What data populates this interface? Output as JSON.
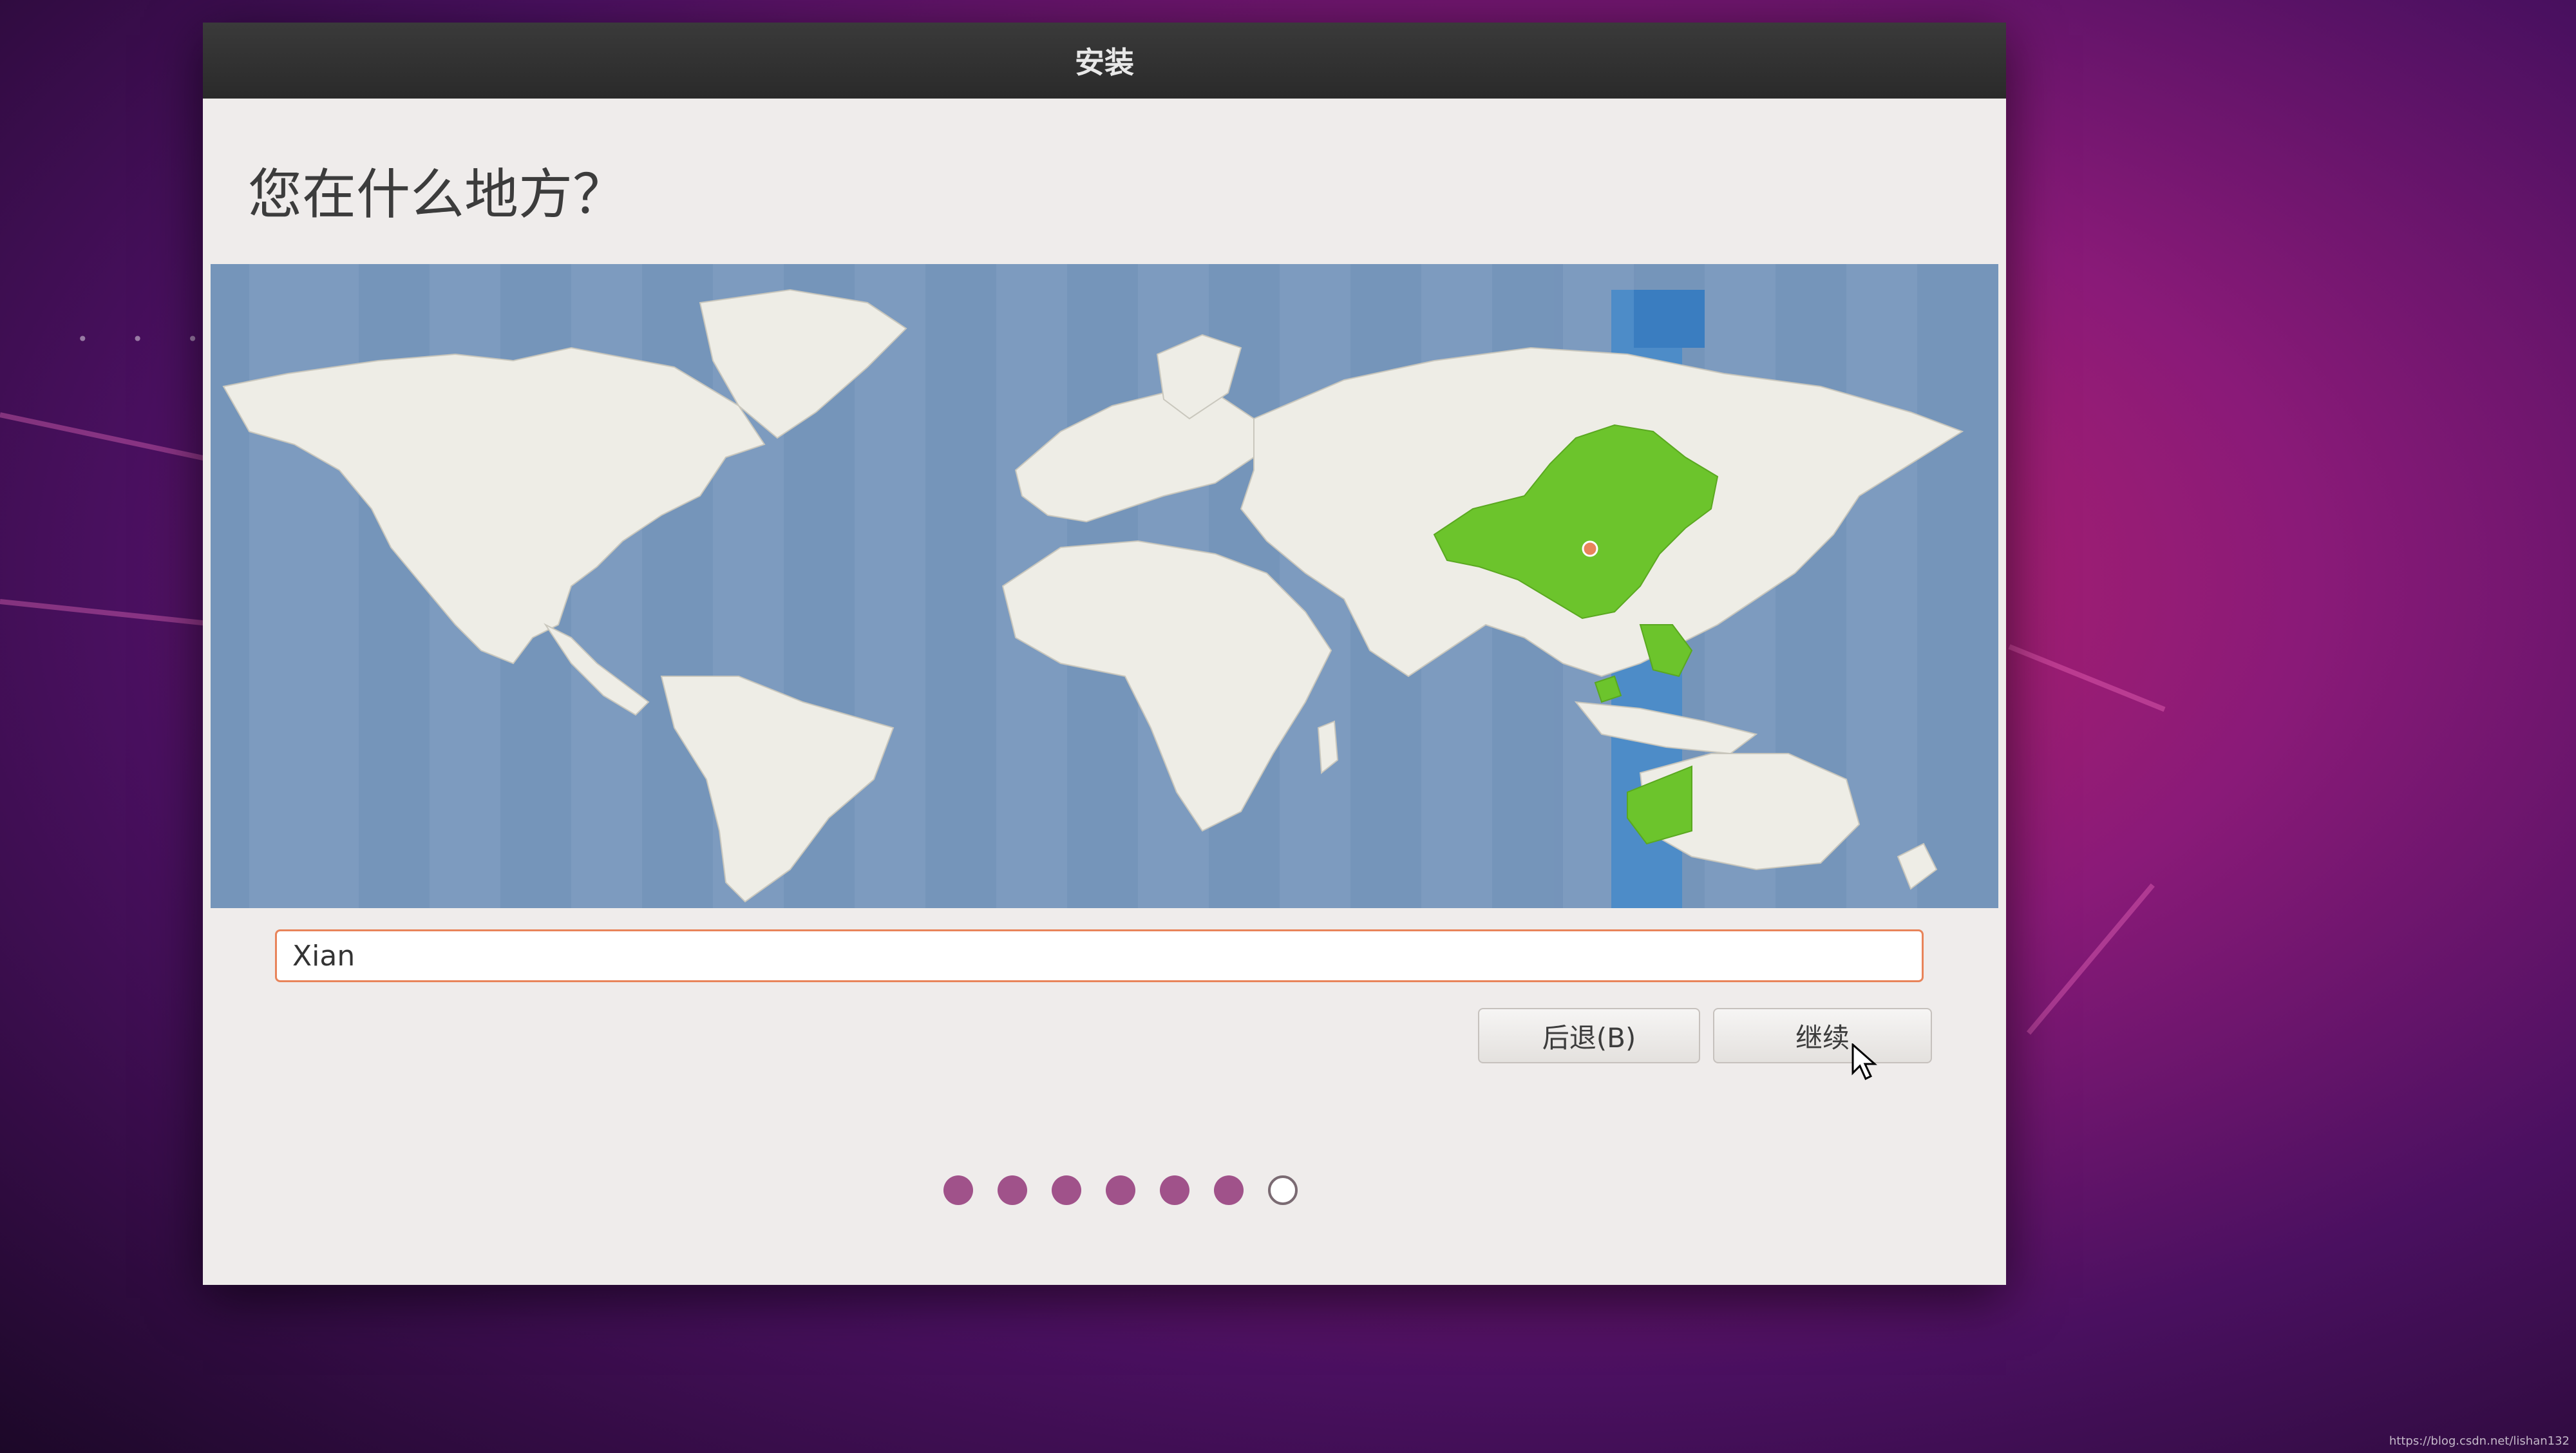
{
  "window": {
    "title": "安装"
  },
  "page": {
    "heading": "您在什么地方？"
  },
  "location_input": {
    "value": "Xian"
  },
  "buttons": {
    "back_label": "后退(B)",
    "continue_label": "继续"
  },
  "progress": {
    "total_steps": 7,
    "completed_steps": 6
  },
  "map": {
    "selected_region_color": "#6cc42c",
    "ocean_color": "#7d9bbf",
    "land_color": "#eeede6",
    "timezone_band_color": "#4d8cc8"
  },
  "colors": {
    "input_focus_border": "#e8845a",
    "progress_dot": "#a0528a"
  },
  "watermark": "https://blog.csdn.net/lishan132"
}
